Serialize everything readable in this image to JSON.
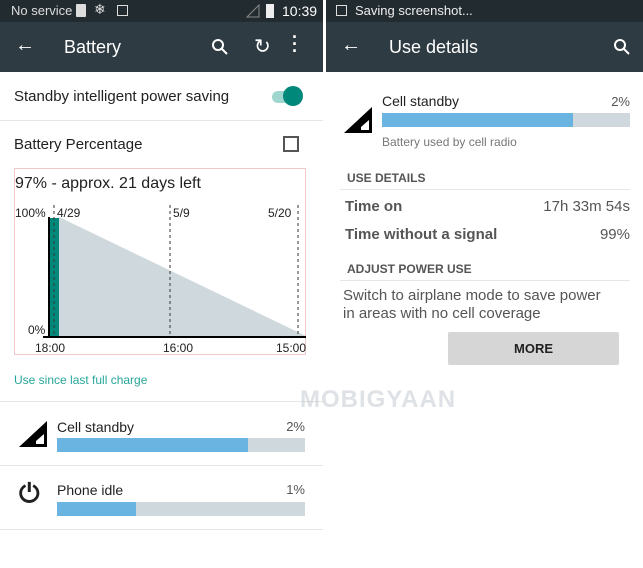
{
  "left": {
    "status": {
      "carrier": "No service",
      "time": "10:39",
      "icons": [
        "sim-alert-icon",
        "snowflake-icon",
        "image-icon",
        "signal-empty-icon",
        "battery-icon"
      ]
    },
    "toolbar": {
      "title": "Battery",
      "icons": [
        "back-arrow-icon",
        "search-icon",
        "refresh-icon",
        "more-vert-icon"
      ]
    },
    "standby_saving": {
      "label": "Standby intelligent power saving",
      "enabled": true
    },
    "battery_percentage": {
      "label": "Battery Percentage",
      "checked": false
    },
    "chart": {
      "title": "97% - approx. 21 days left",
      "y_top": "100%",
      "y_bottom": "0%",
      "date_labels": [
        "4/29",
        "5/9",
        "5/20"
      ],
      "time_labels": [
        "18:00",
        "16:00",
        "15:00"
      ],
      "current_level_percent": 97,
      "accent": "#00897b",
      "projection_color": "#cfd8dc"
    },
    "use_since": "Use since last full charge",
    "items": [
      {
        "label": "Cell standby",
        "value": "2%",
        "bar_percent": 77,
        "icon": "cell-signal-icon"
      },
      {
        "label": "Phone idle",
        "value": "1%",
        "bar_percent": 32,
        "icon": "power-icon"
      }
    ]
  },
  "right": {
    "status": {
      "text": "Saving screenshot..."
    },
    "toolbar": {
      "title": "Use details"
    },
    "header": {
      "label": "Cell standby",
      "value": "2%",
      "bar_percent": 77,
      "subtitle": "Battery used by cell radio"
    },
    "use_details": {
      "heading": "USE DETAILS",
      "rows": [
        {
          "label": "Time on",
          "value": "17h 33m 54s"
        },
        {
          "label": "Time without a signal",
          "value": "99%"
        }
      ]
    },
    "adjust": {
      "heading": "ADJUST POWER USE",
      "text_line1": "Switch to airplane mode to save power",
      "text_line2": "in areas with no cell coverage",
      "button": "MORE"
    }
  },
  "watermark": "MOBIGYAAN"
}
